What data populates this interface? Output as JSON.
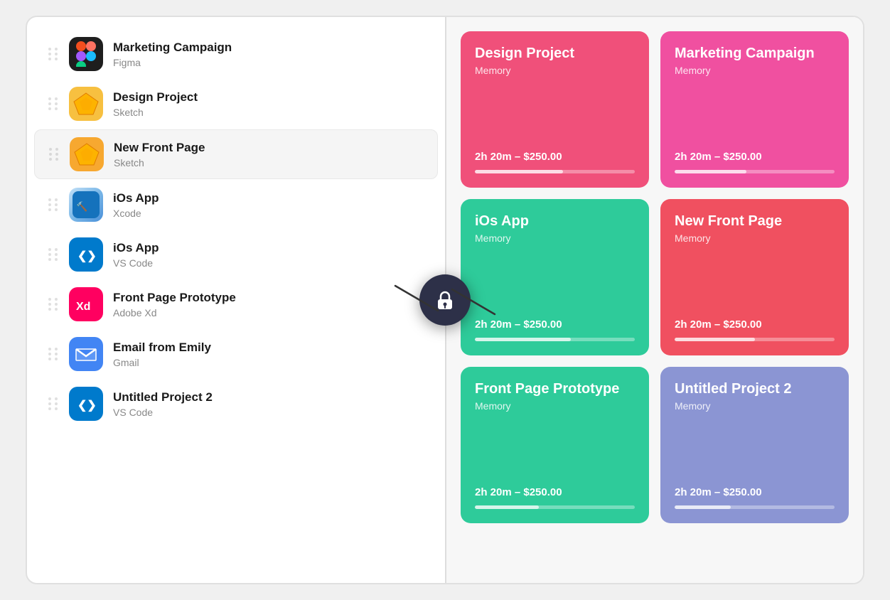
{
  "left_panel": {
    "items": [
      {
        "id": "marketing-campaign",
        "title": "Marketing Campaign",
        "subtitle": "Figma",
        "app": "figma",
        "icon_char": ""
      },
      {
        "id": "design-project",
        "title": "Design Project",
        "subtitle": "Sketch",
        "app": "sketch",
        "icon_char": "◆"
      },
      {
        "id": "new-front-page",
        "title": "New Front Page",
        "subtitle": "Sketch",
        "app": "sketch2",
        "icon_char": "◆",
        "active": true
      },
      {
        "id": "ios-app-xcode",
        "title": "iOs App",
        "subtitle": "Xcode",
        "app": "xcode",
        "icon_char": "🔨"
      },
      {
        "id": "ios-app-vscode",
        "title": "iOs App",
        "subtitle": "VS Code",
        "app": "vscode",
        "icon_char": "❮❯"
      },
      {
        "id": "front-page-prototype",
        "title": "Front Page Prototype",
        "subtitle": "Adobe Xd",
        "app": "adobexd",
        "icon_char": "Xd"
      },
      {
        "id": "email-from-emily",
        "title": "Email from Emily",
        "subtitle": "Gmail",
        "app": "gmail",
        "icon_char": "✉"
      },
      {
        "id": "untitled-project-2",
        "title": "Untitled Project 2",
        "subtitle": "VS Code",
        "app": "vscode2",
        "icon_char": "❮❯"
      }
    ]
  },
  "right_panel": {
    "cards": [
      {
        "id": "design-project-card",
        "title": "Design Project",
        "subtitle": "Memory",
        "price": "2h 20m – $250.00",
        "color": "pink",
        "progress": 55
      },
      {
        "id": "marketing-campaign-card",
        "title": "Marketing Campaign",
        "subtitle": "Memory",
        "price": "2h 20m – $250.00",
        "color": "pink2",
        "progress": 45
      },
      {
        "id": "ios-app-card",
        "title": "iOs App",
        "subtitle": "Memory",
        "price": "2h 20m – $250.00",
        "color": "green",
        "progress": 60
      },
      {
        "id": "new-front-page-card",
        "title": "New Front Page",
        "subtitle": "Memory",
        "price": "2h 20m – $250.00",
        "color": "red",
        "progress": 50
      },
      {
        "id": "front-page-prototype-card",
        "title": "Front Page Prototype",
        "subtitle": "Memory",
        "price": "2h 20m – $250.00",
        "color": "teal",
        "progress": 40
      },
      {
        "id": "untitled-project-2-card",
        "title": "Untitled Project 2",
        "subtitle": "Memory",
        "price": "2h 20m – $250.00",
        "color": "purple",
        "progress": 35
      }
    ]
  },
  "lock_badge": {
    "aria_label": "Lock overlay"
  }
}
